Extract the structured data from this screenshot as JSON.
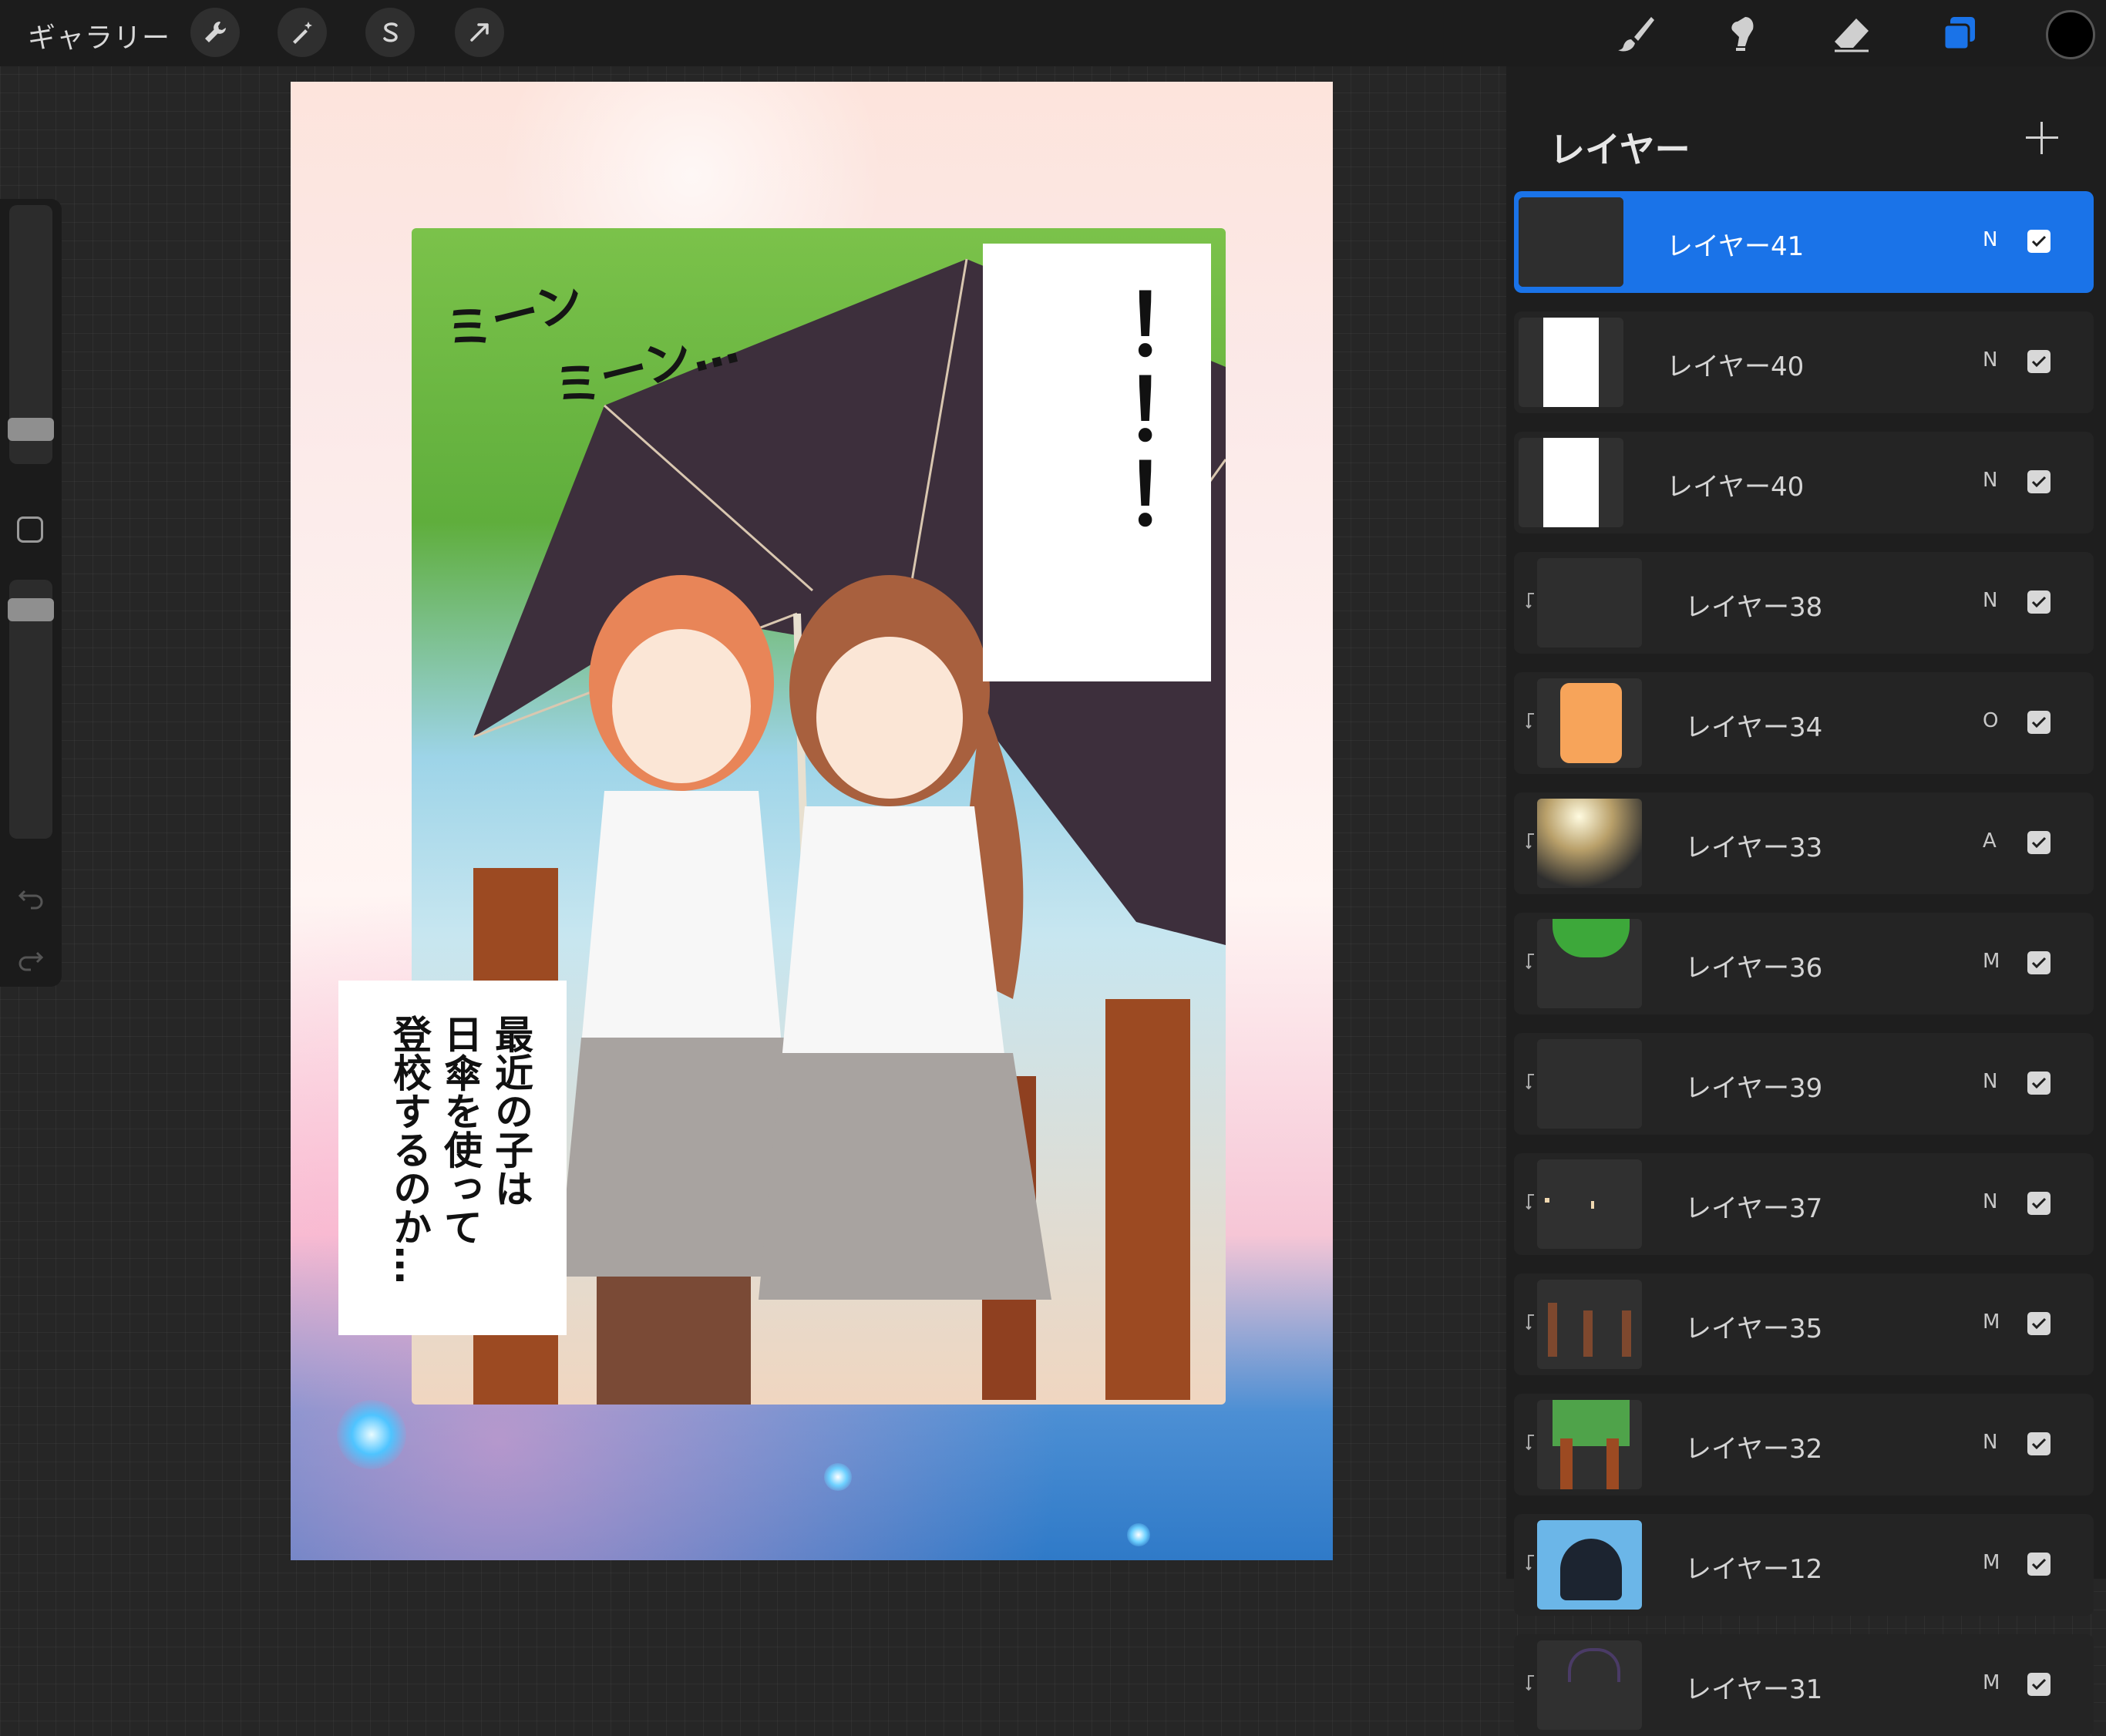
{
  "topbar": {
    "gallery_label": "ギャラリー",
    "left_tools": [
      {
        "icon": "wrench-icon",
        "name": "actions"
      },
      {
        "icon": "magic-wand-icon",
        "name": "adjustments"
      },
      {
        "icon": "selection-s-icon",
        "name": "selection"
      },
      {
        "icon": "arrow-cursor-icon",
        "name": "transform"
      }
    ],
    "right_tools": [
      {
        "icon": "brush-icon",
        "name": "paint"
      },
      {
        "icon": "smudge-icon",
        "name": "smudge"
      },
      {
        "icon": "eraser-icon",
        "name": "erase"
      },
      {
        "icon": "layers-icon",
        "name": "layers",
        "active": true
      }
    ],
    "current_color": "#000000"
  },
  "sidebar": {
    "brush_size_icon": "slider",
    "opacity_icon": "slider",
    "modify_button_icon": "square-icon",
    "undo_icon": "undo-icon",
    "redo_icon": "redo-icon"
  },
  "artwork": {
    "sfx_line1": "ミーン",
    "sfx_line2": "ミーン…",
    "balloon_top": "！！！",
    "balloon_left_col1": "最近の子は",
    "balloon_left_col2": "日傘を使って",
    "balloon_left_col3": "登校するのか…"
  },
  "layers_panel": {
    "title": "レイヤー",
    "add_icon": "plus-icon",
    "layers": [
      {
        "name": "レイヤー41",
        "mode": "N",
        "visible": true,
        "active": true,
        "clipped": false,
        "thumb": "dark"
      },
      {
        "name": "レイヤー40",
        "mode": "N",
        "visible": true,
        "active": false,
        "clipped": false,
        "thumb": "white"
      },
      {
        "name": "レイヤー40",
        "mode": "N",
        "visible": true,
        "active": false,
        "clipped": false,
        "thumb": "white"
      },
      {
        "name": "レイヤー38",
        "mode": "N",
        "visible": true,
        "active": false,
        "clipped": true,
        "thumb": "dark"
      },
      {
        "name": "レイヤー34",
        "mode": "O",
        "visible": true,
        "active": false,
        "clipped": true,
        "thumb": "orange"
      },
      {
        "name": "レイヤー33",
        "mode": "A",
        "visible": true,
        "active": false,
        "clipped": true,
        "thumb": "glow"
      },
      {
        "name": "レイヤー36",
        "mode": "M",
        "visible": true,
        "active": false,
        "clipped": true,
        "thumb": "green"
      },
      {
        "name": "レイヤー39",
        "mode": "N",
        "visible": true,
        "active": false,
        "clipped": true,
        "thumb": "dark"
      },
      {
        "name": "レイヤー37",
        "mode": "N",
        "visible": true,
        "active": false,
        "clipped": true,
        "thumb": "dots"
      },
      {
        "name": "レイヤー35",
        "mode": "M",
        "visible": true,
        "active": false,
        "clipped": true,
        "thumb": "brown"
      },
      {
        "name": "レイヤー32",
        "mode": "N",
        "visible": true,
        "active": false,
        "clipped": true,
        "thumb": "trees"
      },
      {
        "name": "レイヤー12",
        "mode": "M",
        "visible": true,
        "active": false,
        "clipped": true,
        "thumb": "sky"
      },
      {
        "name": "レイヤー31",
        "mode": "M",
        "visible": true,
        "active": false,
        "clipped": true,
        "thumb": "purple"
      }
    ]
  }
}
